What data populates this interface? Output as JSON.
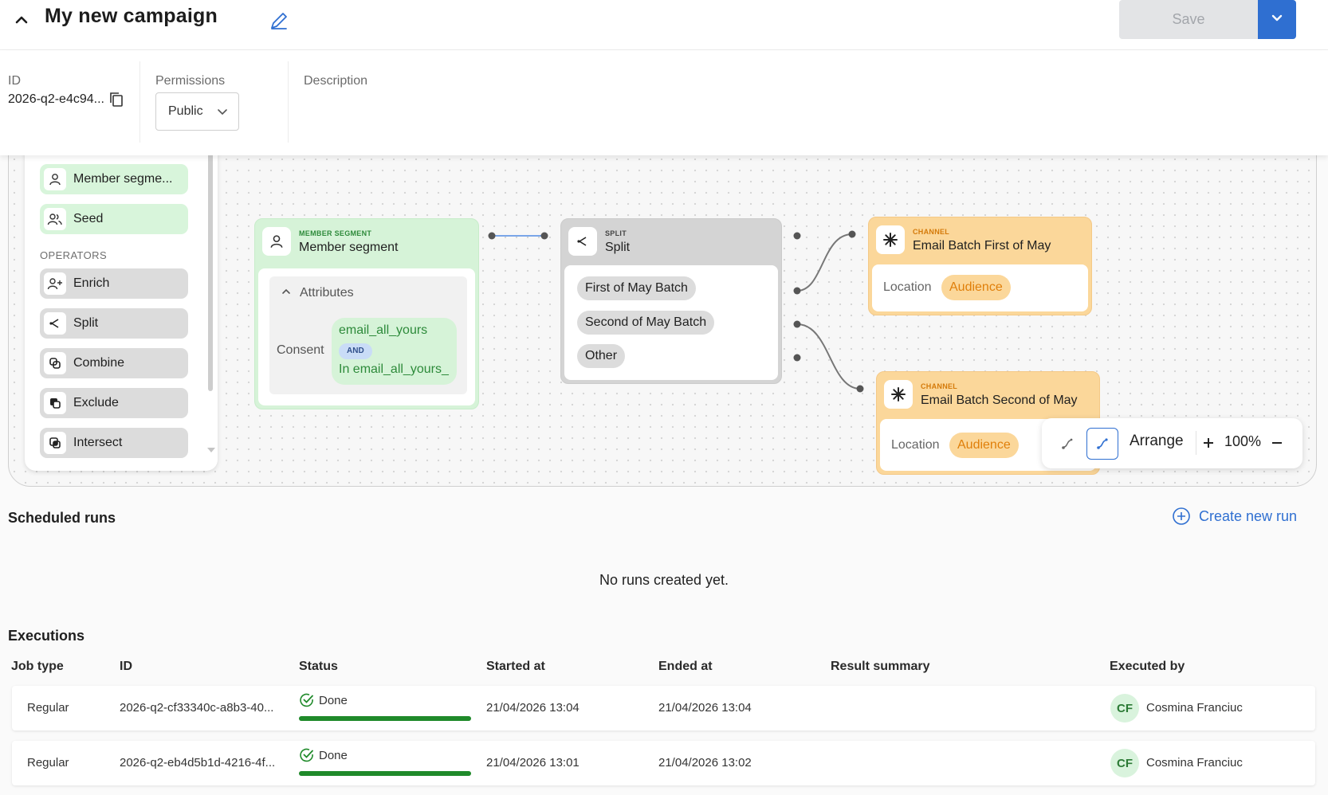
{
  "header": {
    "title": "My new campaign",
    "save_label": "Save"
  },
  "meta": {
    "id_label": "ID",
    "id_value": "2026-q2-e4c94...",
    "permissions_label": "Permissions",
    "permissions_value": "Public",
    "description_label": "Description"
  },
  "palette": {
    "items_top": [
      {
        "label": "Member segme...",
        "icon": "user-icon"
      },
      {
        "label": "Seed",
        "icon": "users-icon"
      }
    ],
    "operators_label": "OPERATORS",
    "operators": [
      {
        "label": "Enrich",
        "icon": "user-plus-icon"
      },
      {
        "label": "Split",
        "icon": "split-icon"
      },
      {
        "label": "Combine",
        "icon": "combine-icon"
      },
      {
        "label": "Exclude",
        "icon": "exclude-icon"
      },
      {
        "label": "Intersect",
        "icon": "intersect-icon"
      }
    ]
  },
  "flow": {
    "segment": {
      "kicker": "MEMBER SEGMENT",
      "title": "Member segment",
      "attributes_label": "Attributes",
      "consent_label": "Consent",
      "value_1": "email_all_yours",
      "operator": "AND",
      "value_2": "In email_all_yours_"
    },
    "split": {
      "kicker": "SPLIT",
      "title": "Split",
      "branches": [
        "First of May Batch",
        "Second of May Batch",
        "Other"
      ]
    },
    "channel_1": {
      "kicker": "CHANNEL",
      "title": "Email Batch First of May",
      "location_label": "Location",
      "location_value": "Audience"
    },
    "channel_2": {
      "kicker": "CHANNEL",
      "title": "Email Batch Second of May",
      "location_label": "Location",
      "location_value": "Audience"
    },
    "toolbar": {
      "arrange_label": "Arrange",
      "zoom": "100%"
    }
  },
  "scheduled_runs": {
    "title": "Scheduled runs",
    "create_label": "Create new run",
    "empty_text": "No runs created yet."
  },
  "executions": {
    "title": "Executions",
    "columns": [
      "Job type",
      "ID",
      "Status",
      "Started at",
      "Ended at",
      "Result summary",
      "Executed by"
    ],
    "rows": [
      {
        "job_type": "Regular",
        "id": "2026-q2-cf33340c-a8b3-40...",
        "status": "Done",
        "progress": 1.0,
        "started": "21/04/2026 13:04",
        "ended": "21/04/2026 13:04",
        "result": "",
        "initials": "CF",
        "executed_by": "Cosmina Franciuc"
      },
      {
        "job_type": "Regular",
        "id": "2026-q2-eb4d5b1d-4216-4f...",
        "status": "Done",
        "progress": 1.0,
        "started": "21/04/2026 13:01",
        "ended": "21/04/2026 13:02",
        "result": "",
        "initials": "CF",
        "executed_by": "Cosmina Franciuc"
      }
    ]
  },
  "colors": {
    "accent": "#2f6fd1",
    "segment_green": "#d6f3d8",
    "channel_orange": "#fbd79a",
    "audience_text": "#e07f0a",
    "done_green": "#1f8a2a"
  }
}
